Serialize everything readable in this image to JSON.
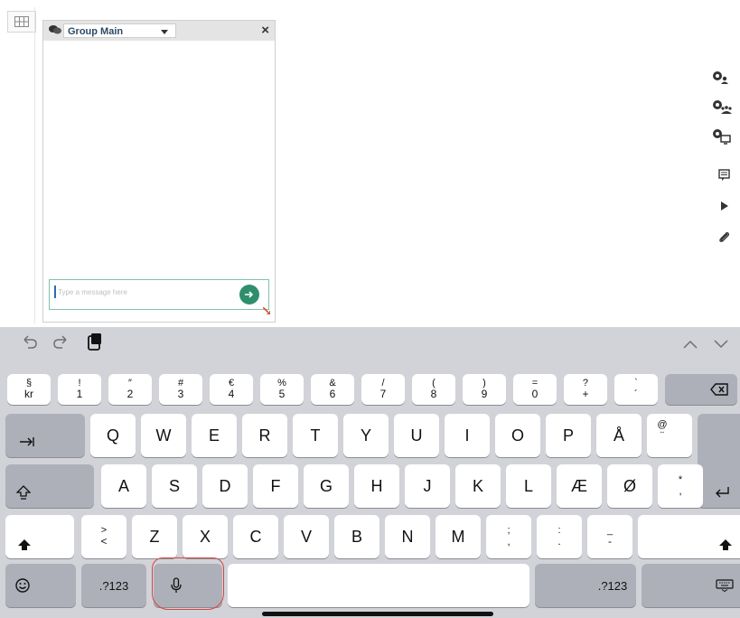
{
  "chat": {
    "group_select": "Group Main",
    "close": "×",
    "input_placeholder": "Type a message here"
  },
  "toolbar_icons": [
    "user-share-icon",
    "group-share-icon",
    "screen-share-icon",
    "chat-icon",
    "play-icon",
    "attachment-icon"
  ],
  "keyboard": {
    "shortcut_icons": [
      "undo-icon",
      "redo-icon",
      "paste-icon"
    ],
    "nav_icons": [
      "chevron-up-icon",
      "chevron-down-icon"
    ],
    "row1": [
      {
        "top": "§",
        "bot": "kr"
      },
      {
        "top": "!",
        "bot": "1"
      },
      {
        "top": "″",
        "bot": "2"
      },
      {
        "top": "#",
        "bot": "3"
      },
      {
        "top": "€",
        "bot": "4"
      },
      {
        "top": "%",
        "bot": "5"
      },
      {
        "top": "&",
        "bot": "6"
      },
      {
        "top": "/",
        "bot": "7"
      },
      {
        "top": "(",
        "bot": "8"
      },
      {
        "top": ")",
        "bot": "9"
      },
      {
        "top": "=",
        "bot": "0"
      },
      {
        "top": "?",
        "bot": "+"
      },
      {
        "top": "`",
        "bot": "´"
      }
    ],
    "row2": [
      "Q",
      "W",
      "E",
      "R",
      "T",
      "Y",
      "U",
      "I",
      "O",
      "P",
      "Å",
      {
        "top": "@",
        "bot": "¨"
      }
    ],
    "row3": [
      "A",
      "S",
      "D",
      "F",
      "G",
      "H",
      "J",
      "K",
      "L",
      "Æ",
      "Ø",
      {
        "top": "*",
        "bot": ","
      }
    ],
    "row4": [
      {
        "top": ">",
        "bot": "<"
      },
      "Z",
      "X",
      "C",
      "V",
      "B",
      "N",
      "M",
      {
        "top": ";",
        "bot": ","
      },
      {
        "top": ":",
        "bot": "."
      },
      {
        "top": "_",
        "bot": "-"
      }
    ],
    "numbers_left": ".?123",
    "numbers_right": ".?123"
  }
}
